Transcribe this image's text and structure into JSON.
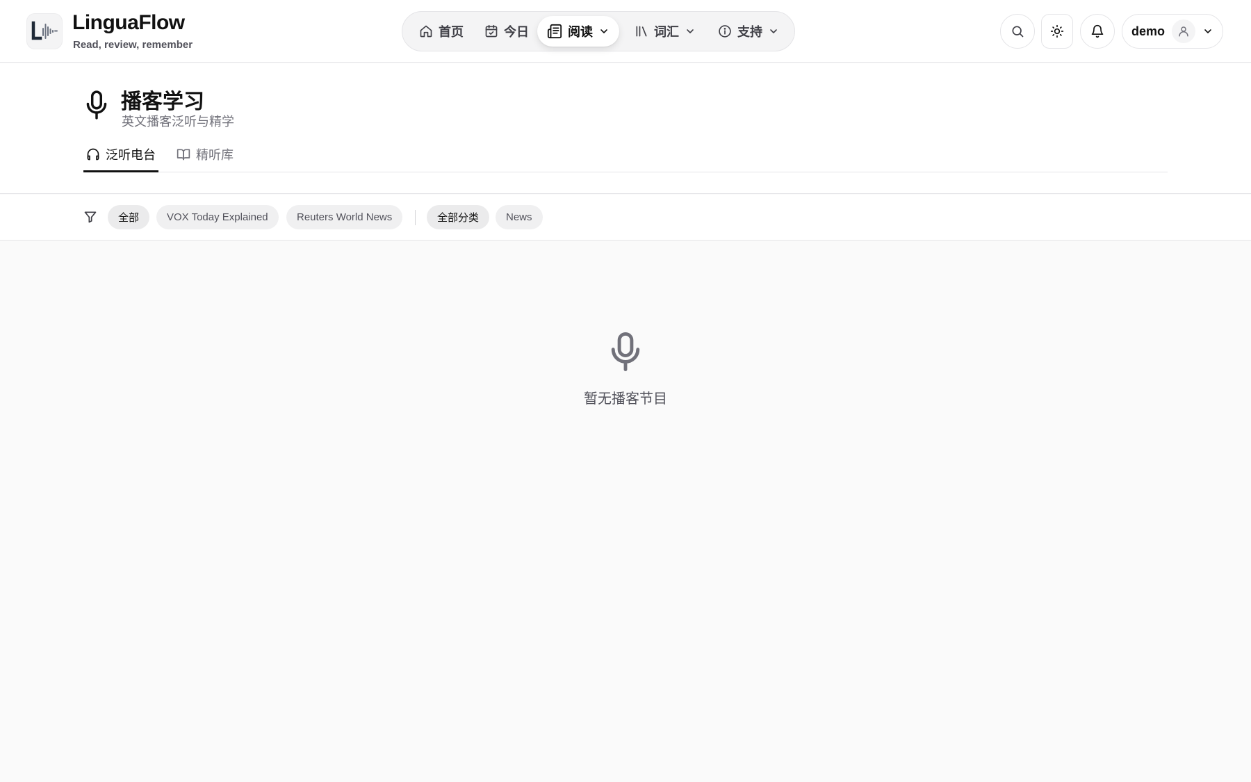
{
  "app": {
    "name": "LinguaFlow",
    "tagline": "Read, review, remember"
  },
  "nav": {
    "items": [
      {
        "label": "首页",
        "icon": "home-icon"
      },
      {
        "label": "今日",
        "icon": "calendar-check-icon"
      },
      {
        "label": "阅读",
        "icon": "newspaper-icon",
        "active": true,
        "has_dropdown": true
      },
      {
        "label": "词汇",
        "icon": "library-icon",
        "has_dropdown": true
      },
      {
        "label": "支持",
        "icon": "info-icon",
        "has_dropdown": true
      }
    ]
  },
  "header_actions": {
    "search_icon": "search-icon",
    "theme_icon": "sun-icon",
    "notifications_icon": "bell-icon",
    "user_name": "demo"
  },
  "page": {
    "title": "播客学习",
    "subtitle": "英文播客泛听与精学",
    "icon": "microphone-icon",
    "tabs": [
      {
        "label": "泛听电台",
        "icon": "headphones-icon",
        "active": true
      },
      {
        "label": "精听库",
        "icon": "book-open-icon",
        "active": false
      }
    ]
  },
  "filters": {
    "sources": [
      {
        "label": "全部",
        "active": true
      },
      {
        "label": "VOX Today Explained",
        "active": false
      },
      {
        "label": "Reuters World News",
        "active": false
      }
    ],
    "categories": [
      {
        "label": "全部分类",
        "active": true
      },
      {
        "label": "News",
        "active": false
      }
    ]
  },
  "empty_state": {
    "icon": "microphone-icon",
    "message": "暂无播客节目"
  },
  "colors": {
    "background": "#fafafa",
    "surface": "#ffffff",
    "border": "#e4e4e7",
    "text_primary": "#111111",
    "text_muted": "#71717a",
    "chip_bg": "#f0f0f1"
  }
}
